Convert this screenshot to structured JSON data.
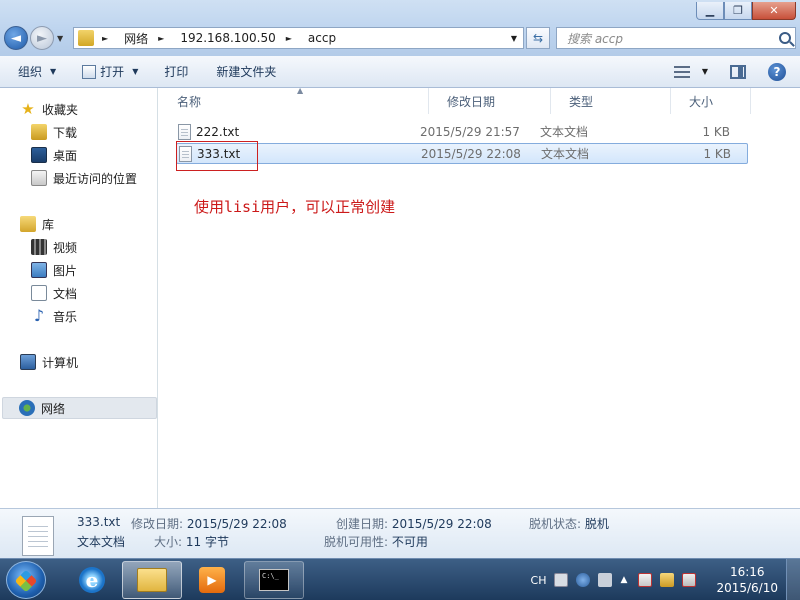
{
  "window": {
    "minimize": "▁",
    "maximize": "❐",
    "close": "✕"
  },
  "nav": {
    "back": "◄",
    "forward": "►",
    "dropdown": "▼"
  },
  "address": {
    "crumbs": [
      "网络",
      "192.168.100.50",
      "accp"
    ],
    "dropdown": "▼"
  },
  "search": {
    "placeholder": "搜索 accp"
  },
  "toolbar": {
    "organize": "组织",
    "open": "打开",
    "print": "打印",
    "new_folder": "新建文件夹",
    "caret": "▼",
    "help": "?"
  },
  "sidebar": {
    "favorites": "收藏夹",
    "downloads": "下载",
    "desktop": "桌面",
    "recent": "最近访问的位置",
    "libraries": "库",
    "videos": "视频",
    "pictures": "图片",
    "documents": "文档",
    "music": "音乐",
    "computer": "计算机",
    "network": "网络"
  },
  "columns": {
    "name": "名称",
    "date": "修改日期",
    "type": "类型",
    "size": "大小"
  },
  "files": [
    {
      "name": "222.txt",
      "date": "2015/5/29 21:57",
      "type": "文本文档",
      "size": "1 KB",
      "selected": false
    },
    {
      "name": "333.txt",
      "date": "2015/5/29 22:08",
      "type": "文本文档",
      "size": "1 KB",
      "selected": true
    }
  ],
  "annotation": "使用lisi用户，可以正常创建",
  "details": {
    "filename": "333.txt",
    "filetype": "文本文档",
    "modified_label": "修改日期:",
    "modified_value": "2015/5/29 22:08",
    "size_label": "大小:",
    "size_value": "11 字节",
    "created_label": "创建日期:",
    "created_value": "2015/5/29 22:08",
    "offline_avail_label": "脱机可用性:",
    "offline_avail_value": "不可用",
    "offline_status_label": "脱机状态:",
    "offline_status_value": "脱机"
  },
  "taskbar": {
    "ie_glyph": "e",
    "media_glyph": "▶",
    "cmd_text": "C:\\_",
    "lang": "CH",
    "time": "16:16",
    "date": "2015/6/10"
  }
}
